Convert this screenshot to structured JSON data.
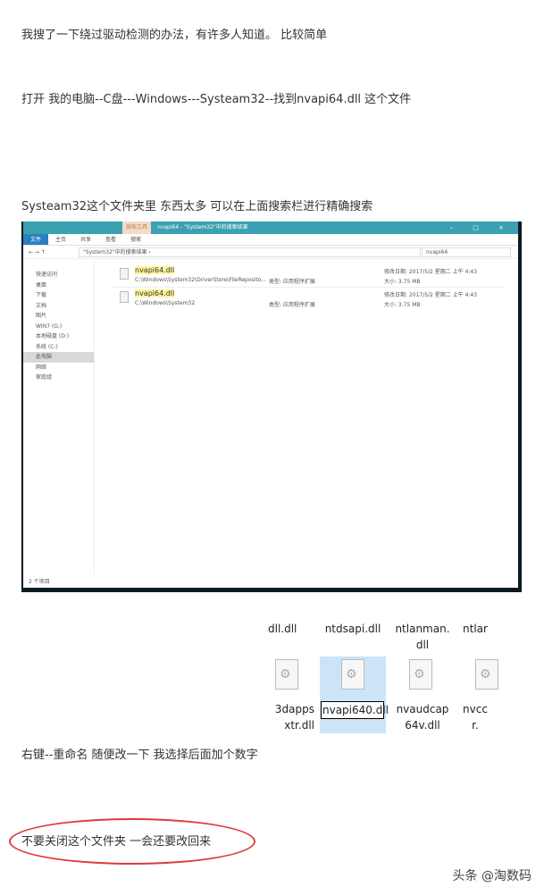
{
  "paragraphs": [
    "我搜了一下绕过驱动检测的办法，有许多人知道。 比较简单",
    "打开 我的电脑--C盘---Windows---Systeam32--找到nvapi64.dll 这个文件",
    "Systeam32这个文件夹里 东西太多 可以在上面搜索栏进行精确搜索",
    "右键--重命名 随便改一下 我选择后面加个数字",
    "不要关闭这个文件夹 一会还要改回来"
  ],
  "explorer": {
    "context_tab": "搜索工具",
    "title": "nvapi64 - \"System32\"中的搜索结果",
    "window_controls": "– □ ×",
    "ribbon": [
      "文件",
      "主页",
      "共享",
      "查看",
      "搜索"
    ],
    "nav_buttons": "← → ↑",
    "address": "\"System32\"中的搜索结果 ›",
    "search_value": "nvapi64",
    "nav": [
      "快速访问",
      "桌面",
      "下载",
      "文档",
      "图片",
      "WIN7 (G:)",
      "本地磁盘 (D:)",
      "系统 (C:)",
      "此电脑",
      "网络",
      "家庭组"
    ],
    "results": [
      {
        "name": "nvapi64.dll",
        "path": "C:\\Windows\\System32\\DriverStore\\FileReposito...",
        "type": "类型: 应用程序扩展",
        "date": "修改日期: 2017/5/2 星期二 上午 4:43",
        "size": "大小: 3.75 MB"
      },
      {
        "name": "nvapi64.dll",
        "path": "C:\\Windows\\System32",
        "type": "类型: 应用程序扩展",
        "date": "修改日期: 2017/5/2 星期二 上午 4:43",
        "size": "大小: 3.75 MB"
      }
    ],
    "status": "2 个项目"
  },
  "rename": {
    "top": [
      "dll.dll",
      "ntdsapi.dll",
      "ntlanman.\ndll",
      "ntlar"
    ],
    "bottom": [
      "3dapps\nxtr.dll",
      "nvaudcap\n64v.dll",
      "nvcc\nr."
    ],
    "editing": "nvapi640.dll"
  },
  "watermark": "头条 @淘数码"
}
